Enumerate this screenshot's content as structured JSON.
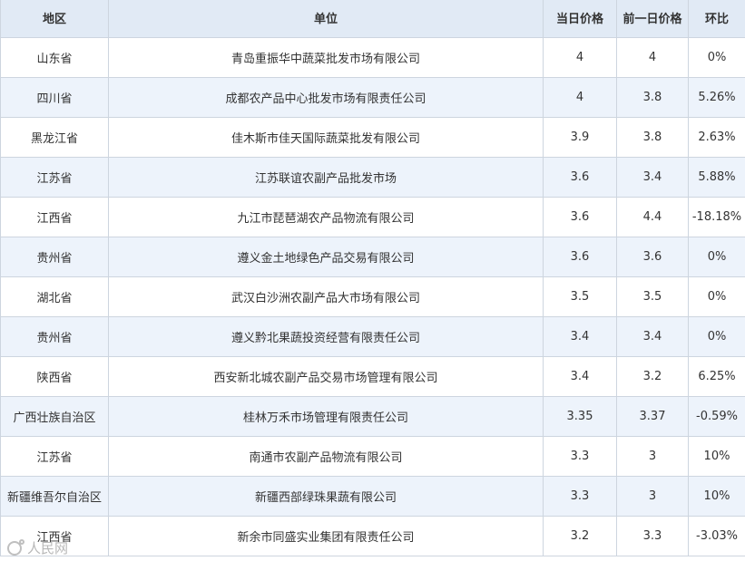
{
  "table": {
    "headers": [
      "地区",
      "单位",
      "当日价格",
      "前一日价格",
      "环比"
    ],
    "rows": [
      [
        "山东省",
        "青岛重振华中蔬菜批发市场有限公司",
        "4",
        "4",
        "0%"
      ],
      [
        "四川省",
        "成都农产品中心批发市场有限责任公司",
        "4",
        "3.8",
        "5.26%"
      ],
      [
        "黑龙江省",
        "佳木斯市佳天国际蔬菜批发有限公司",
        "3.9",
        "3.8",
        "2.63%"
      ],
      [
        "江苏省",
        "江苏联谊农副产品批发市场",
        "3.6",
        "3.4",
        "5.88%"
      ],
      [
        "江西省",
        "九江市琵琶湖农产品物流有限公司",
        "3.6",
        "4.4",
        "-18.18%"
      ],
      [
        "贵州省",
        "遵义金土地绿色产品交易有限公司",
        "3.6",
        "3.6",
        "0%"
      ],
      [
        "湖北省",
        "武汉白沙洲农副产品大市场有限公司",
        "3.5",
        "3.5",
        "0%"
      ],
      [
        "贵州省",
        "遵义黔北果蔬投资经营有限责任公司",
        "3.4",
        "3.4",
        "0%"
      ],
      [
        "陕西省",
        "西安新北城农副产品交易市场管理有限公司",
        "3.4",
        "3.2",
        "6.25%"
      ],
      [
        "广西壮族自治区",
        "桂林万禾市场管理有限责任公司",
        "3.35",
        "3.37",
        "-0.59%"
      ],
      [
        "江苏省",
        "南通市农副产品物流有限公司",
        "3.3",
        "3",
        "10%"
      ],
      [
        "新疆维吾尔自治区",
        "新疆西部绿珠果蔬有限公司",
        "3.3",
        "3",
        "10%"
      ],
      [
        "江西省",
        "新余市同盛实业集团有限责任公司",
        "3.2",
        "3.3",
        "-3.03%"
      ]
    ]
  },
  "watermark": {
    "icon": "camera-logo-icon",
    "text": "人民网"
  },
  "colors": {
    "header_bg": "#e1eaf5",
    "stripe_bg": "#edf3fb",
    "border": "#cdd5df"
  }
}
